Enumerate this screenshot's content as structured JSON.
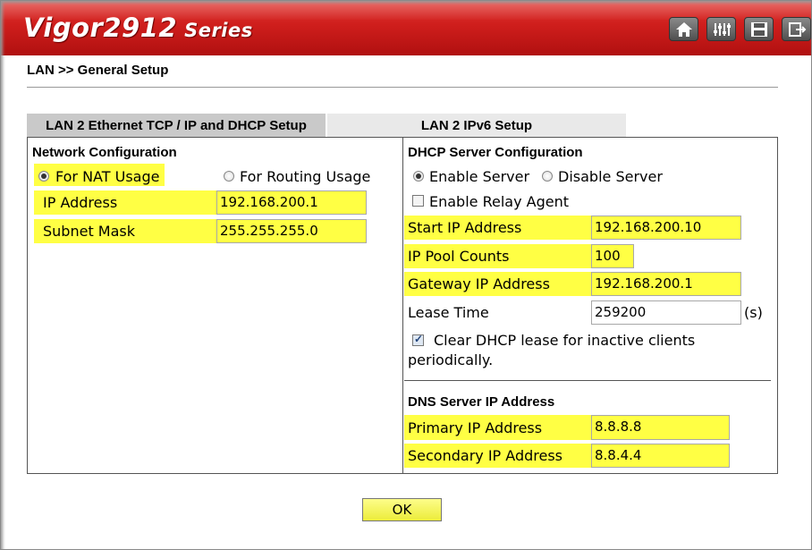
{
  "header": {
    "brand": "Vigor2912",
    "series": "Series",
    "icons": [
      "home-icon",
      "settings-sliders-icon",
      "save-icon",
      "logout-icon"
    ]
  },
  "breadcrumb": "LAN >> General Setup",
  "tabs": [
    {
      "label": "LAN 2 Ethernet TCP / IP and DHCP Setup",
      "active": true
    },
    {
      "label": "LAN 2 IPv6 Setup",
      "active": false
    }
  ],
  "network": {
    "title": "Network Configuration",
    "nat_label": "For NAT Usage",
    "routing_label": "For Routing Usage",
    "mode": "nat",
    "ip_label": "IP Address",
    "ip_value": "192.168.200.1",
    "mask_label": "Subnet Mask",
    "mask_value": "255.255.255.0"
  },
  "dhcp": {
    "title": "DHCP Server Configuration",
    "enable_label": "Enable Server",
    "disable_label": "Disable Server",
    "server_enabled": true,
    "relay_label": "Enable Relay Agent",
    "relay_checked": false,
    "start_ip_label": "Start IP Address",
    "start_ip_value": "192.168.200.10",
    "pool_label": "IP Pool Counts",
    "pool_value": "100",
    "gateway_label": "Gateway IP Address",
    "gateway_value": "192.168.200.1",
    "lease_label": "Lease Time",
    "lease_value": "259200",
    "lease_unit": "(s)",
    "clear_label_line1": "Clear DHCP lease for inactive clients",
    "clear_label_line2": "periodically.",
    "clear_checked": true
  },
  "dns": {
    "title": "DNS Server IP Address",
    "primary_label": "Primary IP Address",
    "primary_value": "8.8.8.8",
    "secondary_label": "Secondary IP Address",
    "secondary_value": "8.8.4.4"
  },
  "ok_label": "OK",
  "colors": {
    "header_red": "#cf1e1c",
    "highlight": "#ffff44",
    "tab_active": "#c9c9c9",
    "tab_inactive": "#e9e9e9",
    "ok_button": "#f4f45c"
  }
}
